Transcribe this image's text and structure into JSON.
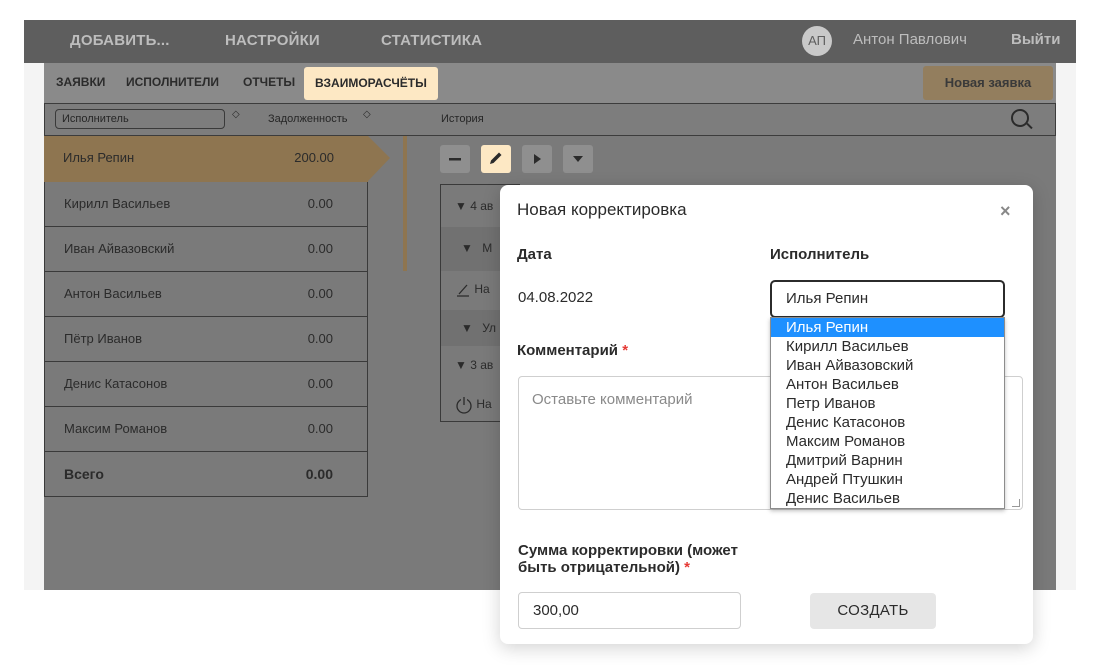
{
  "topbar": {
    "nav": [
      "ДОБАВИТЬ...",
      "НАСТРОЙКИ",
      "СТАТИСТИКА"
    ],
    "avatar": "АП",
    "user_name": "Антон Павлович",
    "logout": "Выйти"
  },
  "subnav": {
    "tabs": [
      "ЗАЯВКИ",
      "ИСПОЛНИТЕЛИ",
      "ОТЧЕТЫ",
      "ВЗАИМОРАСЧЁТЫ"
    ],
    "active_tab": "ВЗАИМОРАСЧЁТЫ",
    "new_order": "Новая заявка"
  },
  "filterbar": {
    "executor_select": "Исполнитель",
    "debt_label": "Задолженность",
    "history_label": "История"
  },
  "table": {
    "rows": [
      {
        "name": "Илья Репин",
        "value": "200.00"
      },
      {
        "name": "Кирилл Васильев",
        "value": "0.00"
      },
      {
        "name": "Иван Айвазовский",
        "value": "0.00"
      },
      {
        "name": "Антон Васильев",
        "value": "0.00"
      },
      {
        "name": "Пётр Иванов",
        "value": "0.00"
      },
      {
        "name": "Денис Катасонов",
        "value": "0.00"
      },
      {
        "name": "Максим Романов",
        "value": "0.00"
      }
    ],
    "total_label": "Всего",
    "total_value": "0.00"
  },
  "history": {
    "fragments": [
      "4 ав",
      "М",
      "На",
      "Ул",
      "3 ав",
      "На"
    ]
  },
  "modal": {
    "title": "Новая корректировка",
    "close": "×",
    "date_label": "Дата",
    "date_value": "04.08.2022",
    "executor_label": "Исполнитель",
    "executor_value": "Илья Репин",
    "comment_label": "Комментарий",
    "required_mark": "*",
    "comment_placeholder": "Оставьте комментарий",
    "sum_label": "Сумма корректировки (может быть отрицательной)",
    "sum_value": "300,00",
    "create_button": "СОЗДАТЬ"
  },
  "dropdown": {
    "options": [
      "Илья Репин",
      "Кирилл Васильев",
      "Иван Айвазовский",
      "Антон Васильев",
      "Петр Иванов",
      "Денис Катасонов",
      "Максим Романов",
      "Дмитрий Варнин",
      "Андрей Птушкин",
      "Денис Васильев"
    ]
  },
  "colors": {
    "accent": "#fde8c4",
    "accent_dark": "#8e7550",
    "selection": "#1e90ff",
    "required": "#e53935"
  }
}
